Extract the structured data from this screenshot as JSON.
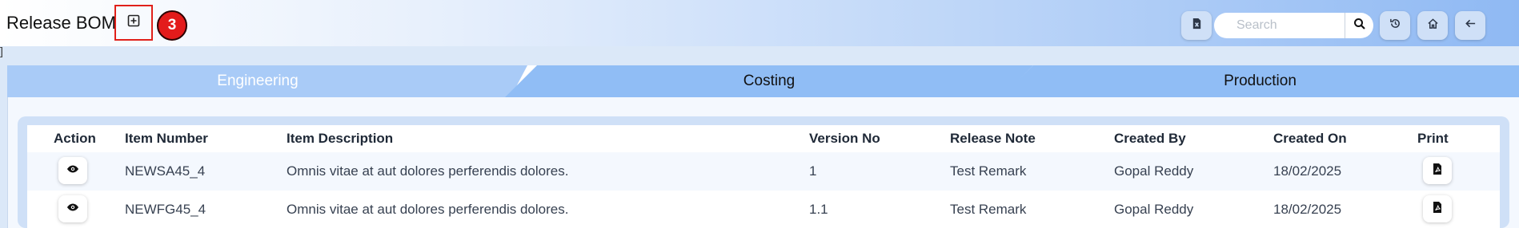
{
  "header": {
    "title": "Release BOM",
    "step_badge": "3",
    "search_placeholder": "Search"
  },
  "icons": {
    "add": "plus-square-icon",
    "report": "file-report-icon",
    "search": "search-icon",
    "history": "history-icon",
    "home": "home-icon",
    "back": "arrow-left-icon",
    "view": "eye-icon",
    "print": "pdf-file-icon"
  },
  "stray_text": "]",
  "tabs": [
    {
      "label": "Engineering"
    },
    {
      "label": "Costing"
    },
    {
      "label": "Production"
    }
  ],
  "table": {
    "columns": [
      "Action",
      "Item Number",
      "Item Description",
      "Version No",
      "Release Note",
      "Created By",
      "Created On",
      "Print"
    ],
    "rows": [
      {
        "item_number": "NEWSA45_4",
        "item_description": "Omnis vitae at aut dolores perferendis dolores.",
        "version_no": "1",
        "release_note": "Test Remark",
        "created_by": "Gopal Reddy",
        "created_on": "18/02/2025"
      },
      {
        "item_number": "NEWFG45_4",
        "item_description": "Omnis vitae at aut dolores perferendis dolores.",
        "version_no": "1.1",
        "release_note": "Test Remark",
        "created_by": "Gopal Reddy",
        "created_on": "18/02/2025"
      }
    ]
  },
  "colors": {
    "accent_red": "#e31b1b",
    "tab_active": "#a9cbf7",
    "tab_inactive": "#90bdf5"
  }
}
